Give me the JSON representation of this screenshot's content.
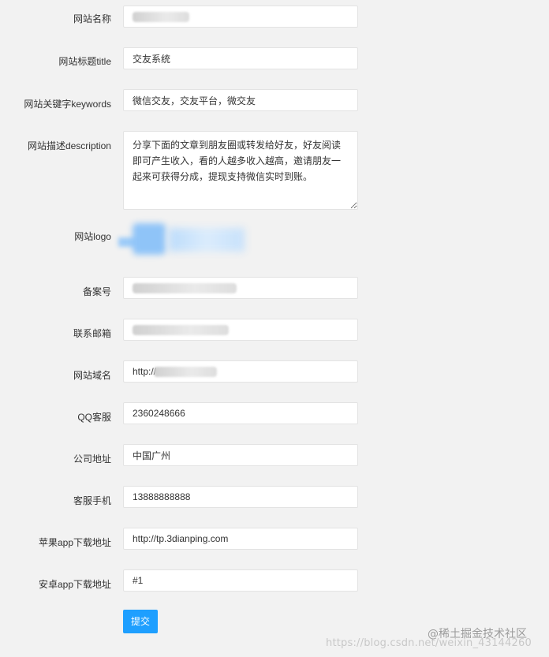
{
  "form": {
    "site_name": {
      "label": "网站名称",
      "value": ""
    },
    "site_title": {
      "label": "网站标题title",
      "value": "交友系统"
    },
    "site_keywords": {
      "label": "网站关键字keywords",
      "value": "微信交友，交友平台，微交友"
    },
    "site_description": {
      "label": "网站描述description",
      "value": "分享下面的文章到朋友圈或转发给好友，好友阅读即可产生收入，看的人越多收入越高，邀请朋友一起来可获得分成，提现支持微信实时到账。"
    },
    "site_logo": {
      "label": "网站logo"
    },
    "icp_number": {
      "label": "备案号",
      "value": ""
    },
    "contact_email": {
      "label": "联系邮箱",
      "value": ""
    },
    "site_domain": {
      "label": "网站域名",
      "value": "http://"
    },
    "qq_service": {
      "label": "QQ客服",
      "value": "2360248666"
    },
    "company_address": {
      "label": "公司地址",
      "value": "中国广州"
    },
    "service_phone": {
      "label": "客服手机",
      "value": "13888888888"
    },
    "ios_download": {
      "label": "苹果app下载地址",
      "value": "http://tp.3dianping.com"
    },
    "android_download": {
      "label": "安卓app下载地址",
      "value": "#1"
    },
    "submit_label": "提交"
  },
  "watermark": {
    "url": "https://blog.csdn.net/weixin_43144260",
    "site": "@稀土掘金技术社区"
  },
  "colors": {
    "background": "#f2f2f2",
    "primary_button": "#1e9fff"
  }
}
